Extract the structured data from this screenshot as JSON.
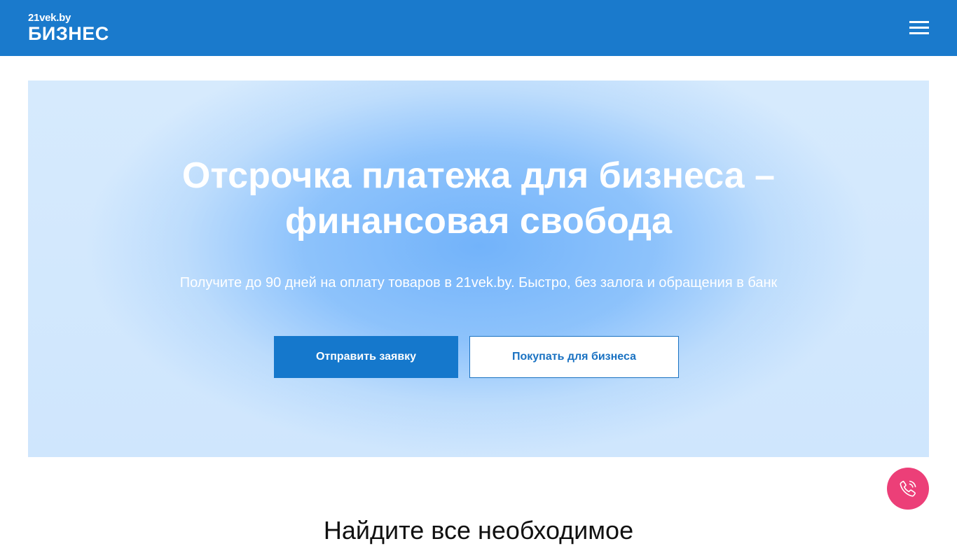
{
  "header": {
    "logo_top": "21vek.by",
    "logo_bottom": "БИЗНЕС",
    "menu_icon": "hamburger-menu-icon",
    "background_color": "#1a7acc"
  },
  "hero": {
    "title_line1": "Отсрочка платежа для бизнеса –",
    "title_line2": "финансовая свобода",
    "subtitle": "Получите до 90 дней на оплату товаров в 21vek.by. Быстро, без залога и обращения в банк",
    "primary_button": "Отправить заявку",
    "secondary_button": "Покупать для бизнеса"
  },
  "call_button": {
    "icon": "phone-call-icon",
    "color": "#ec3f78"
  },
  "next_section": {
    "heading": "Найдите все необходимое"
  }
}
